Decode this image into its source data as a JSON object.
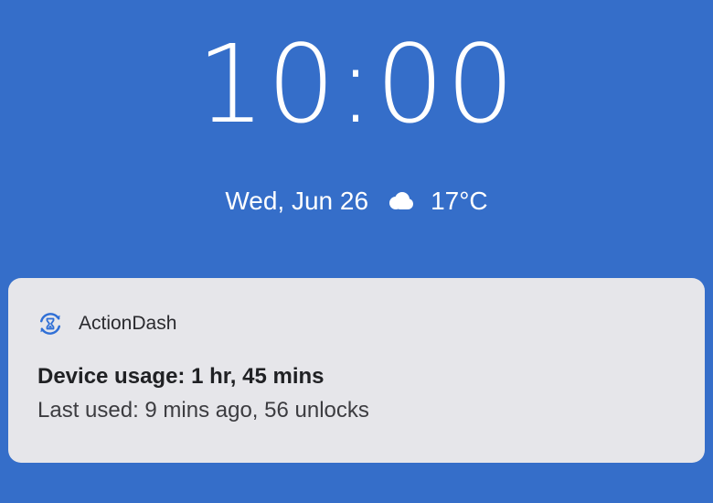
{
  "lockscreen": {
    "time": "10:00",
    "date": "Wed, Jun 26",
    "weather_icon": "cloud-icon",
    "temperature": "17°C"
  },
  "notification": {
    "app_icon": "actiondash-icon",
    "app_name": "ActionDash",
    "title": "Device usage: 1 hr, 45 mins",
    "text": "Last used: 9 mins ago, 56 unlocks"
  },
  "colors": {
    "background": "#356ec9",
    "card": "#e6e6ea",
    "accent": "#2f6fd6"
  }
}
